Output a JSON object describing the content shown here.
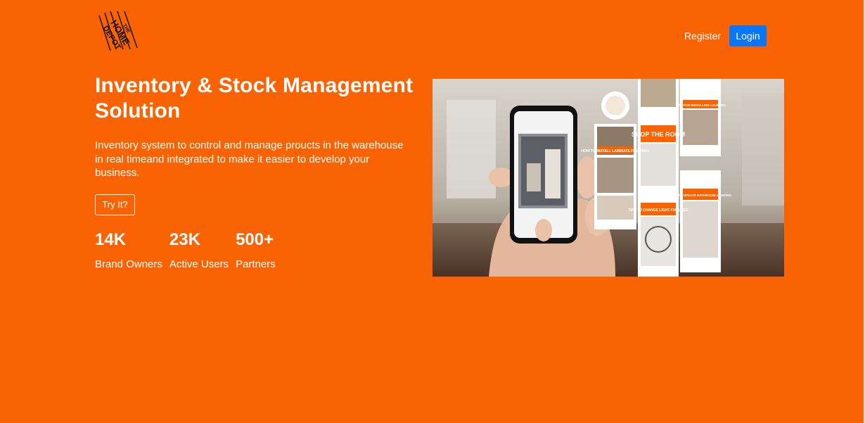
{
  "brand": {
    "logo_text": "THE HOME DEPOT",
    "logo_icon": "home-depot-logo-icon",
    "color": "#f96302"
  },
  "nav": {
    "register_label": "Register",
    "login_label": "Login",
    "login_color": "#0b76f5"
  },
  "hero": {
    "title": "Inventory & Stock Management Solution",
    "description": "Inventory system to control and manage proucts in the warehouse in real timeand integrated to make it easier to develop your business.",
    "cta_label": "Try It?",
    "background": "#fa6303"
  },
  "stats": [
    {
      "value": "14K",
      "label": "Brand Owners"
    },
    {
      "value": "23K",
      "label": "Active Users"
    },
    {
      "value": "500+",
      "label": "Partners"
    }
  ],
  "image": {
    "icon": "phone-in-hand-image",
    "cards": [
      {
        "text": "HOW TO INSTALL LAMINATE FLOORING"
      },
      {
        "text": "SHOP THE ROOM"
      },
      {
        "text": "TIPS FOR INSTALLING LIGHTING"
      },
      {
        "text": "TIPS TO CHANGE LIGHT FIXTURES"
      },
      {
        "text": "HOW TO UPDATE BATHROOM LIGHTING"
      }
    ]
  }
}
